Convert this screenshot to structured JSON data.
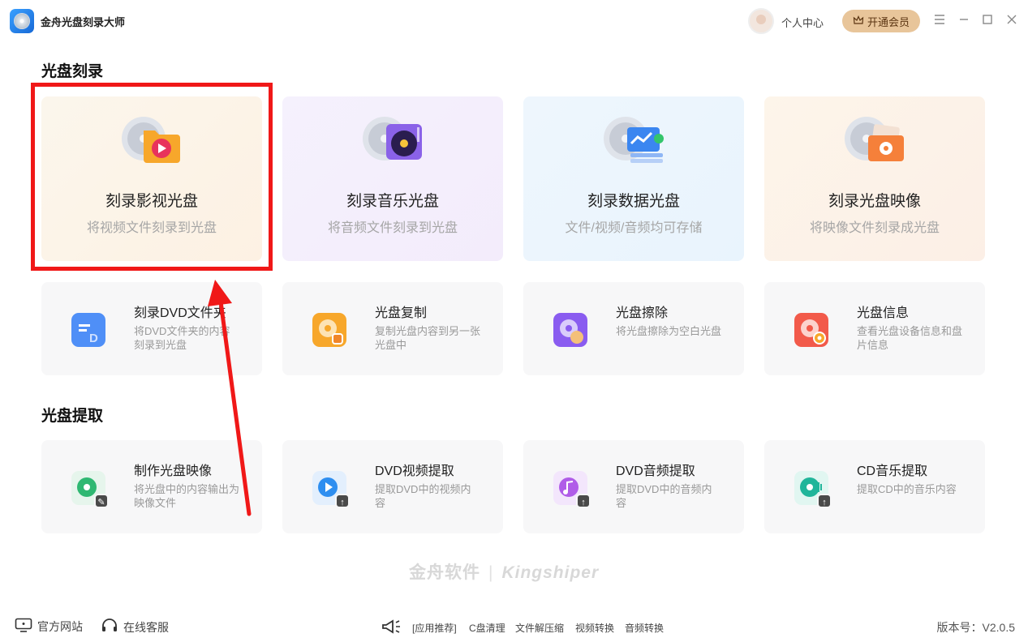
{
  "app": {
    "title": "金舟光盘刻录大师"
  },
  "header": {
    "user_center": "个人中心",
    "vip_label": "开通会员"
  },
  "sections": {
    "burn": "光盘刻录",
    "extract": "光盘提取"
  },
  "burn_cards": [
    {
      "title": "刻录影视光盘",
      "sub": "将视频文件刻录到光盘"
    },
    {
      "title": "刻录音乐光盘",
      "sub": "将音频文件刻录到光盘"
    },
    {
      "title": "刻录数据光盘",
      "sub": "文件/视频/音频均可存储"
    },
    {
      "title": "刻录光盘映像",
      "sub": "将映像文件刻录成光盘"
    }
  ],
  "tool_cards": [
    {
      "title": "刻录DVD文件夹",
      "desc": "将DVD文件夹的内容刻录到光盘"
    },
    {
      "title": "光盘复制",
      "desc": "复制光盘内容到另一张光盘中"
    },
    {
      "title": "光盘擦除",
      "desc": "将光盘擦除为空白光盘"
    },
    {
      "title": "光盘信息",
      "desc": "查看光盘设备信息和盘片信息"
    }
  ],
  "extract_cards": [
    {
      "title": "制作光盘映像",
      "desc": "将光盘中的内容输出为映像文件"
    },
    {
      "title": "DVD视频提取",
      "desc": "提取DVD中的视频内容"
    },
    {
      "title": "DVD音频提取",
      "desc": "提取DVD中的音频内容"
    },
    {
      "title": "CD音乐提取",
      "desc": "提取CD中的音乐内容"
    }
  ],
  "brand": {
    "cn": "金舟软件",
    "sep": "|",
    "en": "Kingshiper"
  },
  "footer": {
    "website": "官方网站",
    "support": "在线客服",
    "links": [
      "[应用推荐]",
      "C盘清理",
      "文件解压缩",
      "视频转换",
      "音频转换"
    ],
    "version": "版本号：V2.0.5"
  },
  "icons": {
    "title_bar": [
      "disc-app-logo",
      "avatar",
      "crown-icon",
      "menu-icon",
      "minimize-icon",
      "maximize-icon",
      "close-icon"
    ],
    "footer": [
      "monitor-icon",
      "headset-icon",
      "megaphone-icon"
    ]
  },
  "colors": {
    "highlight": "#f01818",
    "vip": "#e8c59a",
    "tool_blue": "#4f8ff7",
    "tool_orange": "#f7a72b",
    "tool_purple": "#8a5cf0",
    "tool_red": "#f25a4a",
    "extract_green": "#2fb872",
    "extract_blue": "#2e8ef0",
    "extract_violet": "#b05ce8",
    "extract_teal": "#20b59a"
  }
}
